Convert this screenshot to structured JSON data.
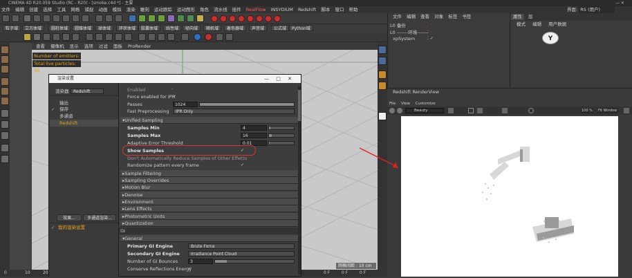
{
  "window": {
    "title": "CINEMA 4D R20.059 Studio (RC - R20) - [smoke.c4d *] - 主要"
  },
  "menubar": {
    "items": [
      "文件",
      "编辑",
      "创建",
      "选择",
      "工具",
      "网格",
      "捕捉",
      "动画",
      "模拟",
      "渲染",
      "雕刻",
      "运动跟踪",
      "运动图形",
      "角色",
      "流水线",
      "插件",
      "RealFlow",
      "INSYDIUM",
      "Redshift",
      "脚本",
      "窗口",
      "帮助"
    ],
    "interface_label": "界面:",
    "interface_value": "RS (用户)"
  },
  "toolbar": {
    "row2_buttons": [
      "粒子域",
      "立方体域",
      "圆柱体域",
      "圆锥体域",
      "球体域",
      "环状体域",
      "胶囊体域",
      "线性域",
      "径向域",
      "随机域",
      "着色器域",
      "声音域",
      "公式域",
      "Python域"
    ]
  },
  "viewport": {
    "menu": [
      "查看",
      "摄像机",
      "显示",
      "选项",
      "过滤",
      "面板",
      "ProRender"
    ],
    "hud": {
      "emitters": "Number of emitters: 1",
      "particles": "Total live particles: 96"
    },
    "grid_spacing": "网格间距 : 10 cm"
  },
  "timeline": {
    "ticks": [
      "0",
      "10",
      "20"
    ],
    "right_ticks": [
      "0 F",
      "0 F",
      "0 F"
    ]
  },
  "object_manager": {
    "tabs": [
      "文件",
      "编辑",
      "查看",
      "对象",
      "标签",
      "书签"
    ],
    "objects": [
      {
        "name": "L0 备份"
      },
      {
        "name": "L0 -------环境-------"
      },
      {
        "name": "xpSystem"
      }
    ]
  },
  "attribute_manager": {
    "tabs": [
      "属性",
      "层"
    ],
    "menu": [
      "模式",
      "编辑",
      "用户数据"
    ]
  },
  "render_view": {
    "title": "Redshift RenderView",
    "menu": [
      "File",
      "View",
      "Customize"
    ],
    "camera": "Beauty",
    "zoom": "100 %",
    "fit": "Fit Window"
  },
  "dialog": {
    "title": "渲染设置",
    "renderer_label": "渲染器",
    "renderer_value": "Redshift",
    "nav": [
      {
        "label": "输出",
        "checked": false,
        "active": false
      },
      {
        "label": "保存",
        "checked": true,
        "active": false
      },
      {
        "label": "多通道",
        "checked": false,
        "active": false
      },
      {
        "label": "Redshift",
        "checked": false,
        "active": true
      }
    ],
    "effects_button": "效果...",
    "multipass_button": "多通道渲染...",
    "my_settings": "我的渲染设置",
    "content": {
      "enabled": "Enabled",
      "force_ipr": "Force enabled for IPR",
      "passes_label": "Passes",
      "passes_value": "1024",
      "passes_fraction": 1.0,
      "fast_preprocessing_label": "Fast Preprocessing",
      "fast_preprocessing_value": "IPR Only",
      "unified_sampling": "Unified Sampling",
      "samples_min_label": "Samples Min",
      "samples_min_value": "4",
      "samples_min_fraction": 0.06,
      "samples_max_label": "Samples Max",
      "samples_max_value": "16",
      "samples_max_fraction": 0.1,
      "adaptive_label": "Adaptive Error Threshold",
      "adaptive_value": "0.01",
      "adaptive_fraction": 0.03,
      "show_samples": "Show Samples",
      "dont_reduce": "Don't Automatically Reduce Samples of Other Effects",
      "randomize": "Randomize pattern every frame",
      "sections": [
        "Sample Filtering",
        "Sampling Overrides",
        "Motion Blur",
        "Denoise",
        "Environment",
        "Lens Effects",
        "Photometric Units",
        "Quantization"
      ],
      "gi_header": "GI",
      "general": "General",
      "primary_gi_label": "Primary GI Engine",
      "primary_gi_value": "Brute Force",
      "secondary_gi_label": "Secondary GI Engine",
      "secondary_gi_value": "Irradiance Point Cloud",
      "gi_bounces_label": "Number of GI Bounces",
      "gi_bounces_value": "3",
      "gi_bounces_fraction": 0.15,
      "conserve_label": "Conserve Reflections Energy"
    }
  },
  "colors": {
    "accent_orange": "#e8a21a",
    "highlight_red": "#dd3333",
    "arrow_red": "#e02020"
  }
}
